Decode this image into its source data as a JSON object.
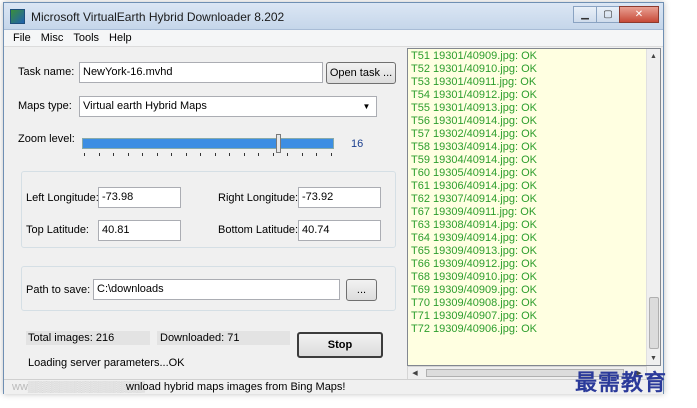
{
  "window": {
    "title": "Microsoft VirtualEarth Hybrid Downloader 8.202",
    "controls": {
      "minimize": "▁",
      "maximize": "▢",
      "close": "✕"
    }
  },
  "menu": {
    "file": "File",
    "misc": "Misc",
    "tools": "Tools",
    "help": "Help"
  },
  "task": {
    "label": "Task name:",
    "value": "NewYork-16.mvhd",
    "open_button": "Open task ..."
  },
  "maps": {
    "label": "Maps type:",
    "value": "Virtual earth Hybrid Maps",
    "arrow_icon": "▼"
  },
  "zoom": {
    "label": "Zoom level:",
    "value": "16",
    "fraction": 0.78
  },
  "coords": {
    "left_lon_label": "Left Longitude:",
    "left_lon_value": "-73.98",
    "right_lon_label": "Right Longitude:",
    "right_lon_value": "-73.92",
    "top_lat_label": "Top Latitude:",
    "top_lat_value": "40.81",
    "bottom_lat_label": "Bottom Latitude:",
    "bottom_lat_value": "40.74"
  },
  "path": {
    "label": "Path to save:",
    "value": "C:\\downloads",
    "browse_button": "..."
  },
  "progress": {
    "total_label": "Total images: 216",
    "downloaded_label": "Downloaded: 71",
    "status": "Loading server parameters...OK",
    "stop_button": "Stop"
  },
  "log": [
    "T51 19301/40909.jpg: OK",
    "T52 19301/40910.jpg: OK",
    "T53 19301/40911.jpg: OK",
    "T54 19301/40912.jpg: OK",
    "T55 19301/40913.jpg: OK",
    "T56 19301/40914.jpg: OK",
    "T57 19302/40914.jpg: OK",
    "T58 19303/40914.jpg: OK",
    "T59 19304/40914.jpg: OK",
    "T60 19305/40914.jpg: OK",
    "T61 19306/40914.jpg: OK",
    "T62 19307/40914.jpg: OK",
    "T67 19309/40911.jpg: OK",
    "T63 19308/40914.jpg: OK",
    "T64 19309/40914.jpg: OK",
    "T65 19309/40913.jpg: OK",
    "T66 19309/40912.jpg: OK",
    "T68 19309/40910.jpg: OK",
    "T69 19309/40909.jpg: OK",
    "T70 19309/40908.jpg: OK",
    "T71 19309/40907.jpg: OK",
    "T72 19309/40906.jpg: OK"
  ],
  "statusbar": {
    "text": "wnload hybrid maps images from Bing Maps!"
  },
  "watermark": "最需教育",
  "colors": {
    "log_text": "#2d9e2d",
    "log_bg": "#ffffe1",
    "slider": "#3c8ee3",
    "zoom_value": "#1b3f8f"
  }
}
